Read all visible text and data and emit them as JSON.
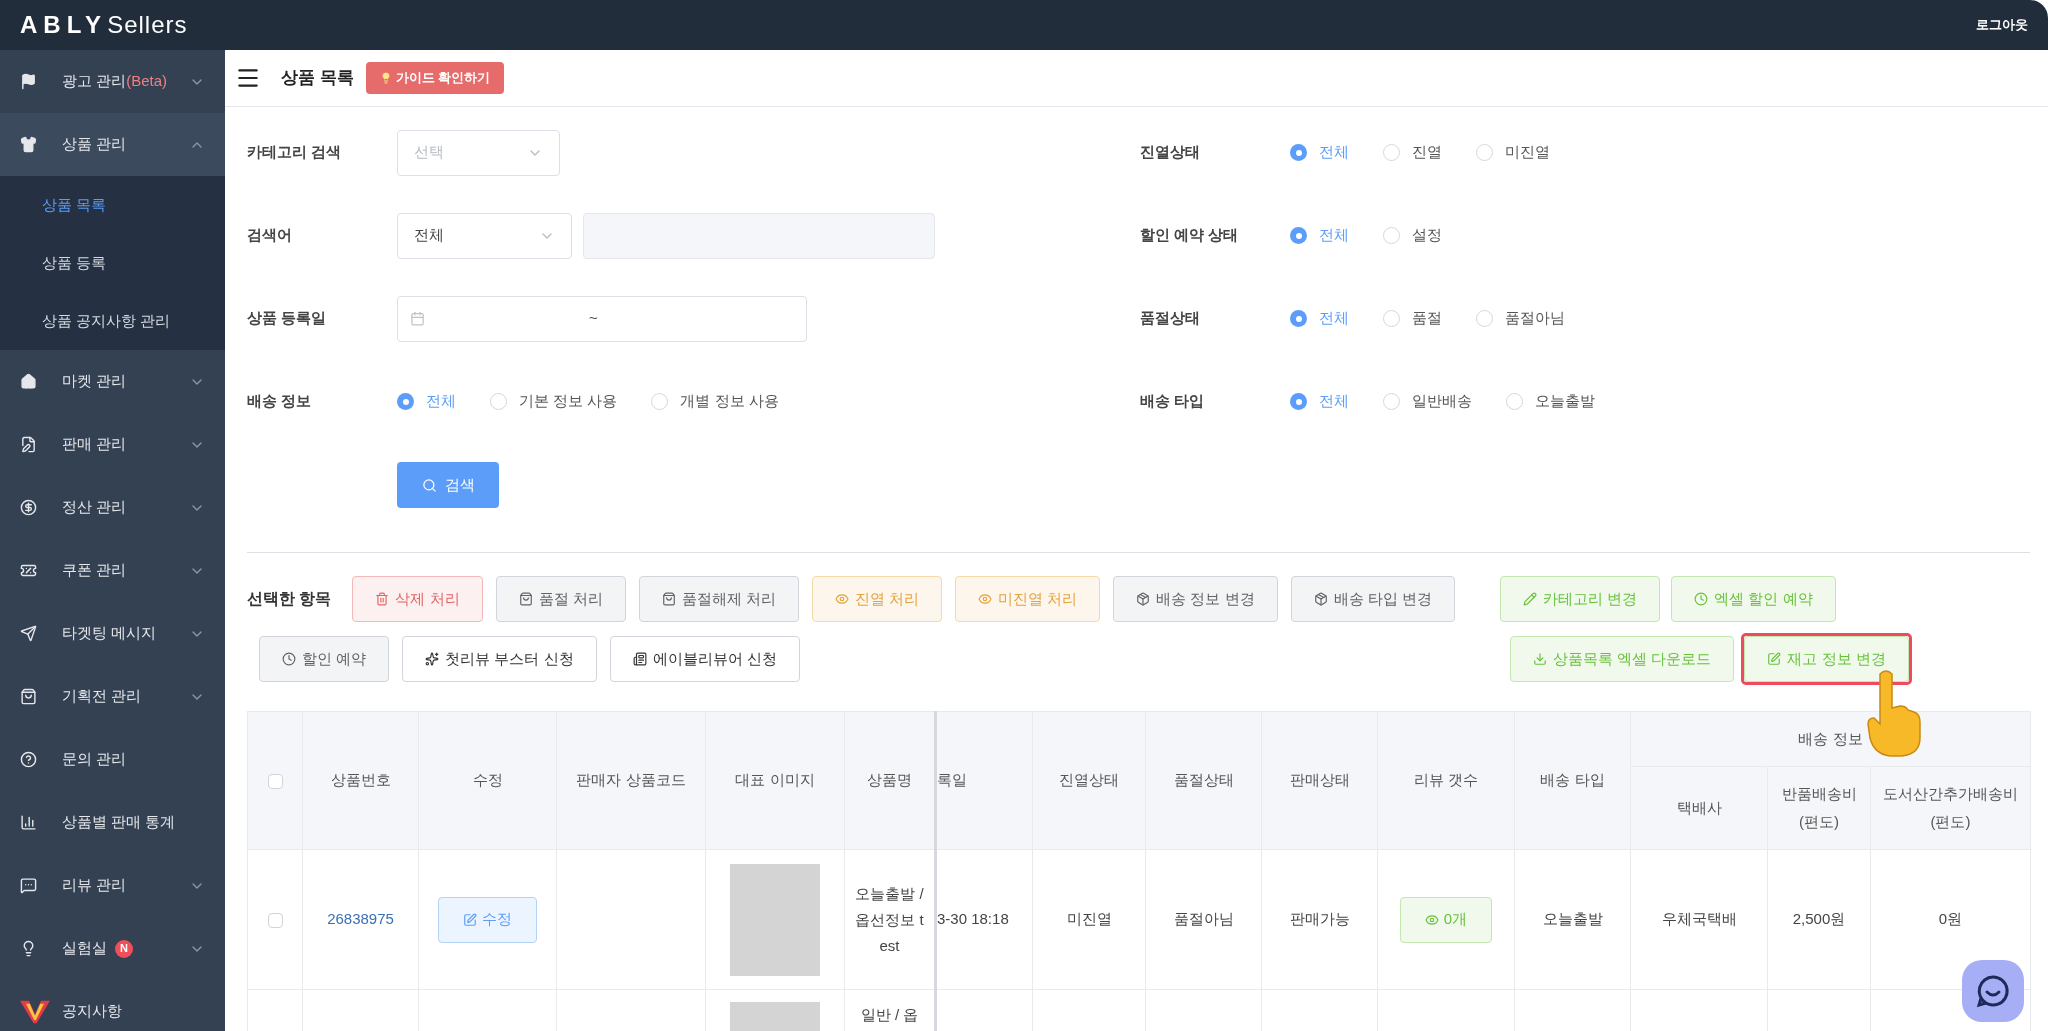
{
  "header": {
    "brand": "ABLY",
    "suffix": "Sellers",
    "logout": "로그아웃"
  },
  "sidebar": {
    "items": [
      {
        "label": "광고 관리",
        "suffix": "(Beta)",
        "expandable": true,
        "expanded": false
      },
      {
        "label": "상품 관리",
        "expandable": true,
        "expanded": true,
        "children": [
          {
            "label": "상품 목록",
            "selected": true
          },
          {
            "label": "상품 등록",
            "selected": false
          },
          {
            "label": "상품 공지사항 관리",
            "selected": false
          }
        ]
      },
      {
        "label": "마켓 관리",
        "expandable": true,
        "expanded": false
      },
      {
        "label": "판매 관리",
        "expandable": true,
        "expanded": false
      },
      {
        "label": "정산 관리",
        "expandable": true,
        "expanded": false
      },
      {
        "label": "쿠폰 관리",
        "expandable": true,
        "expanded": false
      },
      {
        "label": "타겟팅 메시지",
        "expandable": true,
        "expanded": false
      },
      {
        "label": "기획전 관리",
        "expandable": true,
        "expanded": false
      },
      {
        "label": "문의 관리",
        "expandable": false
      },
      {
        "label": "상품별 판매 통계",
        "expandable": false
      },
      {
        "label": "리뷰 관리",
        "expandable": true,
        "expanded": false
      },
      {
        "label": "실험실",
        "badge": "N",
        "expandable": true,
        "expanded": false
      },
      {
        "label": "공지사항",
        "expandable": false
      }
    ]
  },
  "page": {
    "title": "상품 목록",
    "guide_button": "가이드 확인하기"
  },
  "filters_left": [
    {
      "kind": "select",
      "label": "카테고리 검색",
      "placeholder": "선택"
    },
    {
      "kind": "keyword",
      "label": "검색어",
      "value": "전체"
    },
    {
      "kind": "date_range",
      "label": "상품 등록일",
      "separator": "~"
    },
    {
      "kind": "radio",
      "label": "배송 정보",
      "options": [
        {
          "label": "전체",
          "selected": true
        },
        {
          "label": "기본 정보 사용",
          "selected": false
        },
        {
          "label": "개별 정보 사용",
          "selected": false
        }
      ]
    }
  ],
  "search_button": "검색",
  "filters_right": [
    {
      "label": "진열상태",
      "options": [
        {
          "label": "전체",
          "selected": true
        },
        {
          "label": "진열",
          "selected": false
        },
        {
          "label": "미진열",
          "selected": false
        }
      ]
    },
    {
      "label": "할인 예약 상태",
      "options": [
        {
          "label": "전체",
          "selected": true
        },
        {
          "label": "설정",
          "selected": false
        }
      ]
    },
    {
      "label": "품절상태",
      "options": [
        {
          "label": "전체",
          "selected": true
        },
        {
          "label": "품절",
          "selected": false
        },
        {
          "label": "품절아님",
          "selected": false
        }
      ]
    },
    {
      "label": "배송 타입",
      "options": [
        {
          "label": "전체",
          "selected": true
        },
        {
          "label": "일반배송",
          "selected": false
        },
        {
          "label": "오늘출발",
          "selected": false
        }
      ]
    }
  ],
  "actions": {
    "label": "선택한 항목",
    "rows": [
      {
        "left": [
          {
            "label": "삭제 처리",
            "kind": "danger",
            "highlighted": false
          },
          {
            "label": "품절 처리",
            "kind": "neutral",
            "highlighted": false
          },
          {
            "label": "품절해제 처리",
            "kind": "neutral",
            "highlighted": false
          },
          {
            "label": "진열 처리",
            "kind": "warning",
            "highlighted": false
          },
          {
            "label": "미진열 처리",
            "kind": "warning",
            "highlighted": false
          },
          {
            "label": "배송 정보 변경",
            "kind": "neutral",
            "highlighted": false
          },
          {
            "label": "배송 타입 변경",
            "kind": "neutral",
            "highlighted": false
          }
        ],
        "right": [
          {
            "label": "카테고리 변경",
            "kind": "success",
            "highlighted": false
          },
          {
            "label": "엑셀 할인 예약",
            "kind": "success",
            "highlighted": false
          }
        ]
      },
      {
        "left": [
          {
            "label": "할인 예약",
            "kind": "neutral",
            "highlighted": false
          },
          {
            "label": "첫리뷰 부스터 신청",
            "kind": "plain",
            "highlighted": false
          },
          {
            "label": "에이블리뷰어 신청",
            "kind": "plain",
            "highlighted": false
          }
        ],
        "right": [
          {
            "label": "상품목록 엑셀 다운로드",
            "kind": "success",
            "highlighted": false
          },
          {
            "label": "재고 정보 변경",
            "kind": "success",
            "highlighted": true
          }
        ]
      }
    ]
  },
  "table": {
    "header_checkbox": {
      "checked": false
    },
    "columns": [
      "상품번호",
      "수정",
      "판매자 상품코드",
      "대표 이미지",
      "상품명",
      "록일",
      "진열상태",
      "품절상태",
      "판매상태",
      "리뷰 갯수",
      "배송 타입"
    ],
    "group_header": "배송 정보",
    "group_columns": [
      "택배사",
      "반품배송비\n(편도)",
      "도서산간추가배송비\n(편도)"
    ],
    "rows": [
      {
        "checked": false,
        "product_no": "26838975",
        "edit": "수정",
        "product_name": "오늘출발 / 옵선정보 test",
        "registered": "3-30 18:18",
        "display_status": "미진열",
        "soldout_status": "품절아님",
        "sale_status": "판매가능",
        "review_count": "0개",
        "shipping_type": "오늘출발",
        "courier": "우체국택배",
        "return_fee": "2,500원",
        "extra_fee": "0원"
      },
      {
        "product_name": "일반 / 옵"
      }
    ]
  }
}
